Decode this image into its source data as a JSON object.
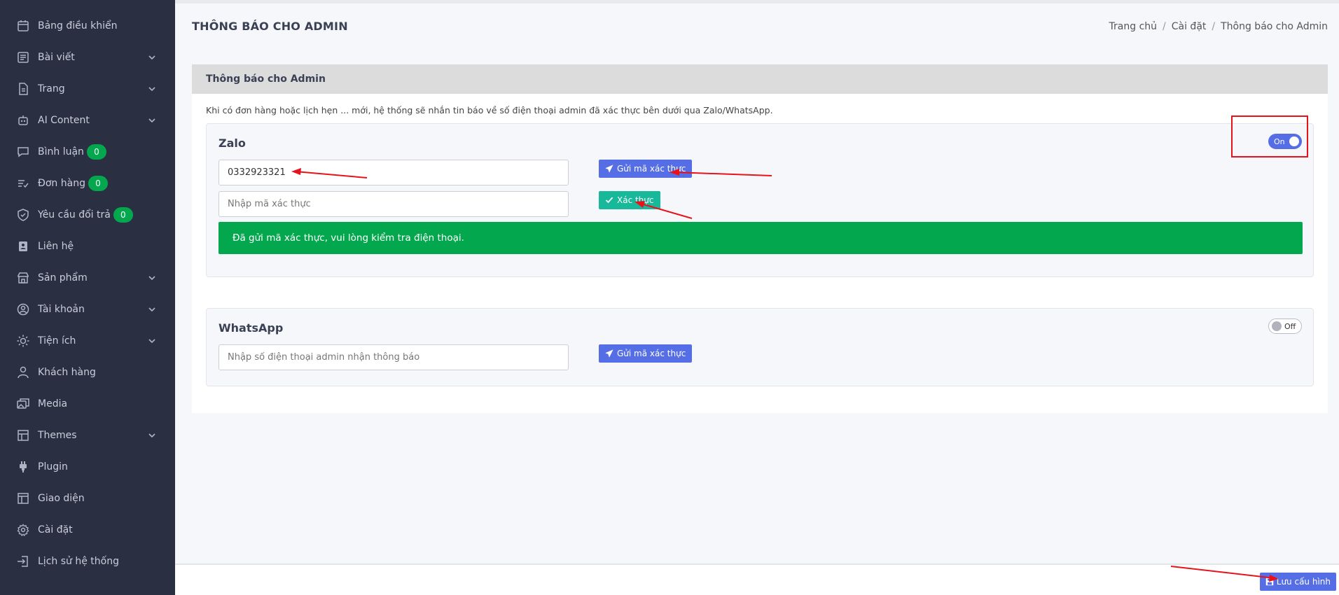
{
  "sidebar": {
    "items": [
      {
        "label": "Bảng điều khiển",
        "icon": "calendar-icon",
        "chevron": false
      },
      {
        "label": "Bài viết",
        "icon": "list-icon",
        "chevron": true
      },
      {
        "label": "Trang",
        "icon": "document-icon",
        "chevron": true
      },
      {
        "label": "AI Content",
        "icon": "robot-icon",
        "chevron": true
      },
      {
        "label": "Bình luận",
        "icon": "comment-icon",
        "chevron": false,
        "badge": "0"
      },
      {
        "label": "Đơn hàng",
        "icon": "order-list-icon",
        "chevron": false,
        "badge": "0"
      },
      {
        "label": "Yêu cầu đổi trả",
        "icon": "shield-icon",
        "chevron": false,
        "badge": "0"
      },
      {
        "label": "Liên hệ",
        "icon": "contact-icon",
        "chevron": false
      },
      {
        "label": "Sản phẩm",
        "icon": "store-icon",
        "chevron": true
      },
      {
        "label": "Tài khoản",
        "icon": "user-circle-icon",
        "chevron": true
      },
      {
        "label": "Tiện ích",
        "icon": "sun-icon",
        "chevron": true
      },
      {
        "label": "Khách hàng",
        "icon": "user-icon",
        "chevron": false
      },
      {
        "label": "Media",
        "icon": "images-icon",
        "chevron": false
      },
      {
        "label": "Themes",
        "icon": "grid-icon",
        "chevron": true
      },
      {
        "label": "Plugin",
        "icon": "plug-icon",
        "chevron": false
      },
      {
        "label": "Giao diện",
        "icon": "layout-icon",
        "chevron": false
      },
      {
        "label": "Cài đặt",
        "icon": "gear-icon",
        "chevron": false
      },
      {
        "label": "Lịch sử hệ thống",
        "icon": "login-icon",
        "chevron": false
      }
    ]
  },
  "header": {
    "title": "THÔNG BÁO CHO ADMIN",
    "breadcrumb": [
      "Trang chủ",
      "Cài đặt",
      "Thông báo cho Admin"
    ]
  },
  "card": {
    "title": "Thông báo cho Admin",
    "description": "Khi có đơn hàng hoặc lịch hẹn ... mới, hệ thống sẽ nhắn tin báo về số điện thoại admin đã xác thực bên dưới qua Zalo/WhatsApp."
  },
  "zalo": {
    "title": "Zalo",
    "toggle_label": "On",
    "phone_value": "0332923321",
    "code_placeholder": "Nhập mã xác thực",
    "send_button": "Gửi mã xác thực",
    "verify_button": "Xác thực",
    "alert": "Đã gửi mã xác thực, vui lòng kiểm tra điện thoại."
  },
  "whatsapp": {
    "title": "WhatsApp",
    "toggle_label": "Off",
    "phone_placeholder": "Nhập số điện thoại admin nhận thông báo",
    "send_button": "Gửi mã xác thực"
  },
  "footer": {
    "save_button": "Lưu cấu hình"
  },
  "colors": {
    "sidebar_bg": "#2a3042",
    "primary": "#556ee6",
    "success": "#03a84e",
    "teal": "#18b89a",
    "annotation": "#e8131a"
  }
}
